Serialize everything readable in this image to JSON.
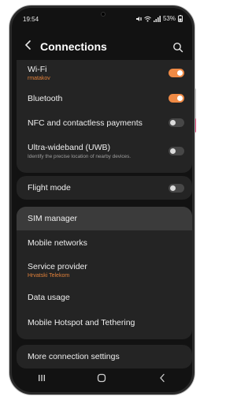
{
  "status_bar": {
    "time": "19:54",
    "battery": "53%",
    "icons": [
      "mute-icon",
      "wifi-icon",
      "signal-icon",
      "battery-icon"
    ]
  },
  "header": {
    "title": "Connections",
    "back_icon": "chevron-left-icon",
    "search_icon": "search-icon"
  },
  "connections_card": [
    {
      "label": "Wi-Fi",
      "sub": "rmatakov",
      "toggle": "on"
    },
    {
      "label": "Bluetooth",
      "toggle": "on"
    },
    {
      "label": "NFC and contactless payments",
      "toggle": "off"
    },
    {
      "label": "Ultra-wideband (UWB)",
      "sub": "Identify the precise location of nearby devices.",
      "toggle": "off"
    }
  ],
  "flight_mode": {
    "label": "Flight mode",
    "toggle": "off"
  },
  "network_card": [
    {
      "label": "SIM manager"
    },
    {
      "label": "Mobile networks"
    },
    {
      "label": "Service provider",
      "sub": "Hrvatski Telekom"
    },
    {
      "label": "Data usage"
    },
    {
      "label": "Mobile Hotspot and Tethering"
    }
  ],
  "more_settings": {
    "label": "More connection settings"
  },
  "navbar": [
    "recents-icon",
    "home-icon",
    "back-icon"
  ],
  "colors": {
    "accent": "#ef8a45",
    "background": "#121212",
    "card": "#242424"
  }
}
